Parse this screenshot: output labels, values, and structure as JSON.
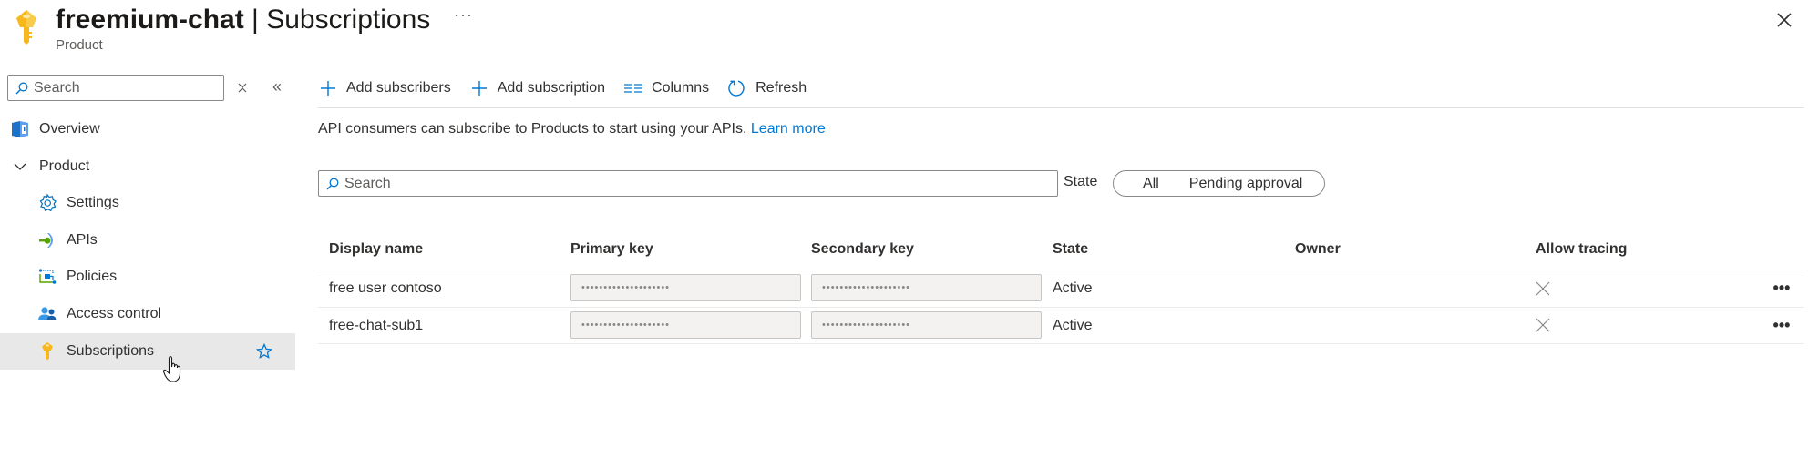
{
  "header": {
    "resource_name": "freemium-chat",
    "separator": " | ",
    "page_name": "Subscriptions",
    "subtitle": "Product",
    "more_label": "···",
    "icon": "key-icon",
    "close_icon": "close-icon"
  },
  "sidebar": {
    "search": {
      "placeholder": "Search",
      "value": ""
    },
    "clear_icon": "clear-filter-icon",
    "collapse_icon": "collapse-icon",
    "collapse_label": "«",
    "items": [
      {
        "label": "Overview",
        "icon": "overview-icon",
        "level": 0
      },
      {
        "label": "Product",
        "icon": "chevron-down-icon",
        "level": 0,
        "expanded": true
      },
      {
        "label": "Settings",
        "icon": "gear-icon",
        "level": 1
      },
      {
        "label": "APIs",
        "icon": "api-icon",
        "level": 1
      },
      {
        "label": "Policies",
        "icon": "policies-icon",
        "level": 1
      },
      {
        "label": "Access control",
        "icon": "access-control-icon",
        "level": 1
      },
      {
        "label": "Subscriptions",
        "icon": "key-icon",
        "level": 1,
        "selected": true,
        "favorite_icon": "star-icon"
      }
    ]
  },
  "toolbar": {
    "buttons": [
      {
        "label": "Add subscribers",
        "icon": "plus-icon"
      },
      {
        "label": "Add subscription",
        "icon": "plus-icon"
      },
      {
        "label": "Columns",
        "icon": "columns-icon"
      },
      {
        "label": "Refresh",
        "icon": "refresh-icon"
      }
    ]
  },
  "info": {
    "text": "API consumers can subscribe to Products to start using your APIs.",
    "link": "Learn more"
  },
  "filter": {
    "search": {
      "placeholder": "Search",
      "value": ""
    },
    "state_label": "State",
    "state_options": [
      "All",
      "Pending approval"
    ],
    "state_selected": "All"
  },
  "table": {
    "columns": [
      "Display name",
      "Primary key",
      "Secondary key",
      "State",
      "Owner",
      "Allow tracing"
    ],
    "rows": [
      {
        "display_name": "free user contoso",
        "primary_key": "••••••••••••••••••••",
        "secondary_key": "••••••••••••••••••••",
        "state": "Active",
        "owner": "",
        "allow_tracing": false,
        "more_label": "•••"
      },
      {
        "display_name": "free-chat-sub1",
        "primary_key": "••••••••••••••••••••",
        "secondary_key": "••••••••••••••••••••",
        "state": "Active",
        "owner": "",
        "allow_tracing": false,
        "more_label": "•••"
      }
    ]
  },
  "colors": {
    "accent": "#0078d4",
    "selected_bg": "#e8e8e8",
    "key_yellow": "#f2b01e",
    "text": "#323130"
  }
}
